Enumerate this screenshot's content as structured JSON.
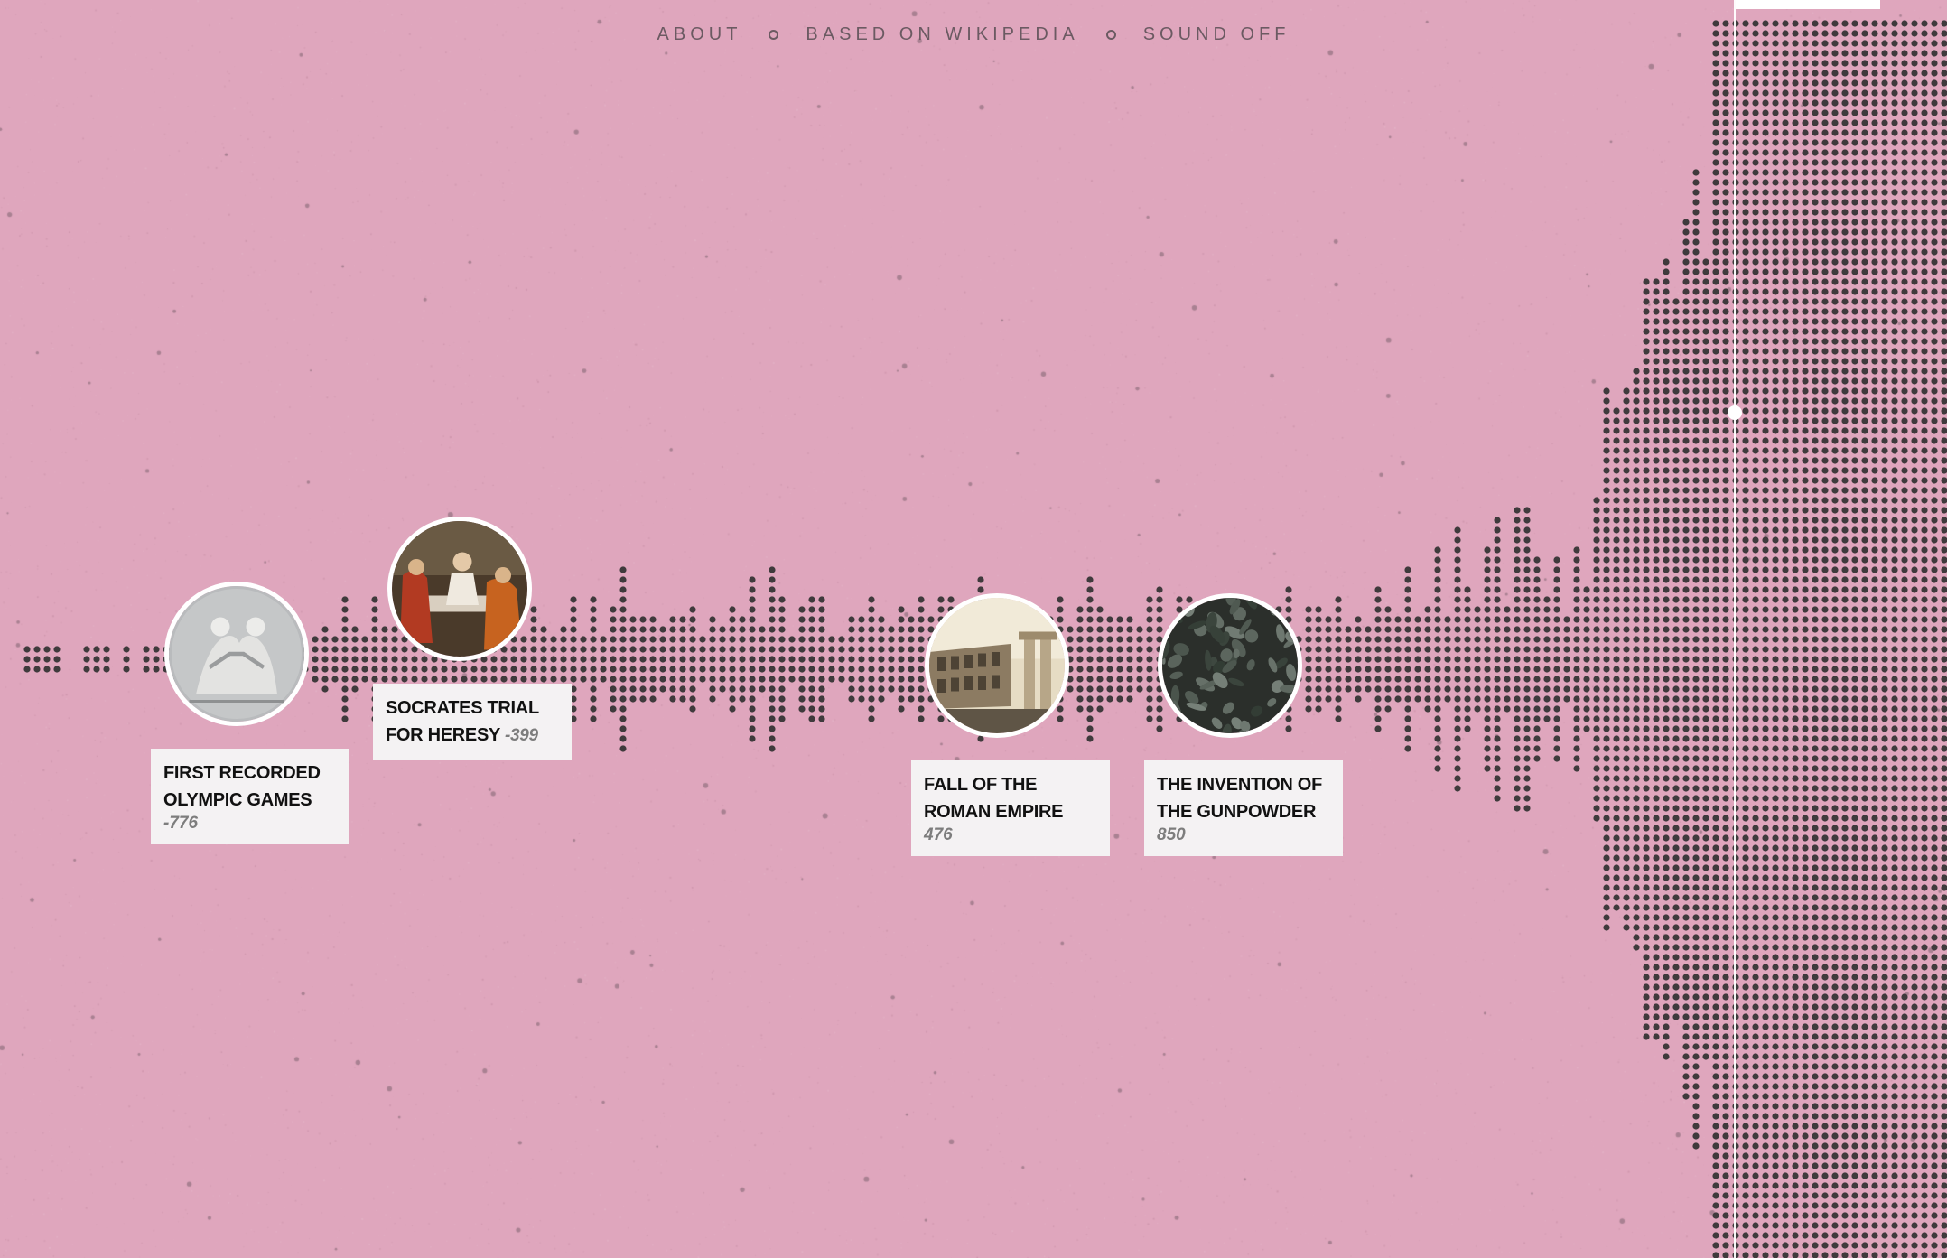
{
  "nav": {
    "about": "ABOUT",
    "based_on": "BASED ON WIKIPEDIA",
    "sound": "SOUND OFF"
  },
  "colors": {
    "background": "#dfa6bd",
    "dots": "#3f3a3c",
    "card": "#f4f2f3",
    "playhead": "#ffffff"
  },
  "events": [
    {
      "id": "olympics",
      "title": "FIRST RECORDED OLYMPIC GAMES",
      "year": "-776",
      "icon": "olympic-relief-image"
    },
    {
      "id": "socrates",
      "title": "SOCRATES TRIAL FOR HERESY",
      "year": "-399",
      "icon": "socrates-painting-image"
    },
    {
      "id": "rome",
      "title": "FALL OF THE ROMAN EMPIRE",
      "year": "476",
      "icon": "colosseum-image"
    },
    {
      "id": "gunpowder",
      "title": "THE INVENTION OF THE GUNPOWDER",
      "year": "850",
      "icon": "gunpowder-image"
    }
  ]
}
